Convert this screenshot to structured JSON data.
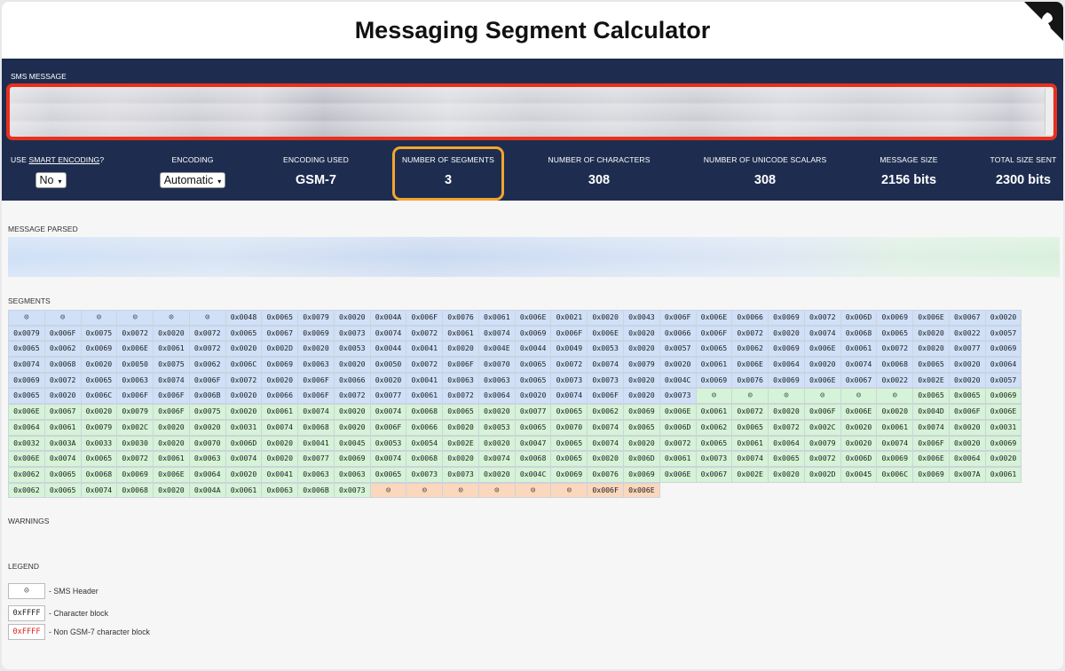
{
  "title": "Messaging Segment Calculator",
  "sms_label": "SMS MESSAGE",
  "stats": {
    "smart_prefix": "USE ",
    "smart_link": "SMART ENCODING",
    "smart_suffix": "?",
    "smart_value": "No",
    "encoding_label": "ENCODING",
    "encoding_value": "Automatic",
    "encoding_used_label": "ENCODING USED",
    "encoding_used_value": "GSM-7",
    "segments_label": "NUMBER OF SEGMENTS",
    "segments_value": "3",
    "chars_label": "NUMBER OF CHARACTERS",
    "chars_value": "308",
    "scalars_label": "NUMBER OF UNICODE SCALARS",
    "scalars_value": "308",
    "size_label": "MESSAGE SIZE",
    "size_value": "2156 bits",
    "total_label": "TOTAL SIZE SENT",
    "total_value": "2300 bits"
  },
  "sections": {
    "parsed": "MESSAGE PARSED",
    "segments": "SEGMENTS",
    "warnings": "WARNINGS",
    "legend": "LEGEND"
  },
  "legend": [
    {
      "box": "☺",
      "text": "- SMS Header"
    },
    {
      "box": "0xFFFF",
      "text": "- Character block"
    },
    {
      "box": "0xFFFF",
      "text": "- Non GSM-7 character block",
      "red": true
    }
  ],
  "colors": {
    "header_bg": "#1e2d4f",
    "segment1": "#cfe0f8",
    "segment2": "#d5f3d6",
    "segment3": "#fad7bd",
    "highlight_red": "#e8301c",
    "highlight_orange": "#f2a62e"
  },
  "segment_rows": [
    [
      [
        "H",
        "b"
      ],
      [
        "H",
        "b"
      ],
      [
        "H",
        "b"
      ],
      [
        "H",
        "b"
      ],
      [
        "H",
        "b"
      ],
      [
        "H",
        "b"
      ],
      [
        "0x0048",
        "b"
      ],
      [
        "0x0065",
        "b"
      ],
      [
        "0x0079",
        "b"
      ],
      [
        "0x0020",
        "b"
      ],
      [
        "0x004A",
        "b"
      ],
      [
        "0x006F",
        "b"
      ],
      [
        "0x0076",
        "b"
      ],
      [
        "0x0061",
        "b"
      ],
      [
        "0x006E",
        "b"
      ],
      [
        "0x0021",
        "b"
      ],
      [
        "0x0020",
        "b"
      ],
      [
        "0x0043",
        "b"
      ],
      [
        "0x006F",
        "b"
      ],
      [
        "0x006E",
        "b"
      ],
      [
        "0x0066",
        "b"
      ],
      [
        "0x0069",
        "b"
      ],
      [
        "0x0072",
        "b"
      ],
      [
        "0x006D",
        "b"
      ],
      [
        "0x0069",
        "b"
      ],
      [
        "0x006E",
        "b"
      ],
      [
        "0x0067",
        "b"
      ],
      [
        "0x0020",
        "b"
      ]
    ],
    [
      [
        "0x0079",
        "b"
      ],
      [
        "0x006F",
        "b"
      ],
      [
        "0x0075",
        "b"
      ],
      [
        "0x0072",
        "b"
      ],
      [
        "0x0020",
        "b"
      ],
      [
        "0x0072",
        "b"
      ],
      [
        "0x0065",
        "b"
      ],
      [
        "0x0067",
        "b"
      ],
      [
        "0x0069",
        "b"
      ],
      [
        "0x0073",
        "b"
      ],
      [
        "0x0074",
        "b"
      ],
      [
        "0x0072",
        "b"
      ],
      [
        "0x0061",
        "b"
      ],
      [
        "0x0074",
        "b"
      ],
      [
        "0x0069",
        "b"
      ],
      [
        "0x006F",
        "b"
      ],
      [
        "0x006E",
        "b"
      ],
      [
        "0x0020",
        "b"
      ],
      [
        "0x0066",
        "b"
      ],
      [
        "0x006F",
        "b"
      ],
      [
        "0x0072",
        "b"
      ],
      [
        "0x0020",
        "b"
      ],
      [
        "0x0074",
        "b"
      ],
      [
        "0x0068",
        "b"
      ],
      [
        "0x0065",
        "b"
      ],
      [
        "0x0020",
        "b"
      ],
      [
        "0x0022",
        "b"
      ],
      [
        "0x0057",
        "b"
      ]
    ],
    [
      [
        "0x0065",
        "b"
      ],
      [
        "0x0062",
        "b"
      ],
      [
        "0x0069",
        "b"
      ],
      [
        "0x006E",
        "b"
      ],
      [
        "0x0061",
        "b"
      ],
      [
        "0x0072",
        "b"
      ],
      [
        "0x0020",
        "b"
      ],
      [
        "0x002D",
        "b"
      ],
      [
        "0x0020",
        "b"
      ],
      [
        "0x0053",
        "b"
      ],
      [
        "0x0044",
        "b"
      ],
      [
        "0x0041",
        "b"
      ],
      [
        "0x0020",
        "b"
      ],
      [
        "0x004E",
        "b"
      ],
      [
        "0x0044",
        "b"
      ],
      [
        "0x0049",
        "b"
      ],
      [
        "0x0053",
        "b"
      ],
      [
        "0x0020",
        "b"
      ],
      [
        "0x0057",
        "b"
      ],
      [
        "0x0065",
        "b"
      ],
      [
        "0x0062",
        "b"
      ],
      [
        "0x0069",
        "b"
      ],
      [
        "0x006E",
        "b"
      ],
      [
        "0x0061",
        "b"
      ],
      [
        "0x0072",
        "b"
      ],
      [
        "0x0020",
        "b"
      ],
      [
        "0x0077",
        "b"
      ],
      [
        "0x0069",
        "b"
      ]
    ],
    [
      [
        "0x0074",
        "b"
      ],
      [
        "0x0068",
        "b"
      ],
      [
        "0x0020",
        "b"
      ],
      [
        "0x0050",
        "b"
      ],
      [
        "0x0075",
        "b"
      ],
      [
        "0x0062",
        "b"
      ],
      [
        "0x006C",
        "b"
      ],
      [
        "0x0069",
        "b"
      ],
      [
        "0x0063",
        "b"
      ],
      [
        "0x0020",
        "b"
      ],
      [
        "0x0050",
        "b"
      ],
      [
        "0x0072",
        "b"
      ],
      [
        "0x006F",
        "b"
      ],
      [
        "0x0070",
        "b"
      ],
      [
        "0x0065",
        "b"
      ],
      [
        "0x0072",
        "b"
      ],
      [
        "0x0074",
        "b"
      ],
      [
        "0x0079",
        "b"
      ],
      [
        "0x0020",
        "b"
      ],
      [
        "0x0061",
        "b"
      ],
      [
        "0x006E",
        "b"
      ],
      [
        "0x0064",
        "b"
      ],
      [
        "0x0020",
        "b"
      ],
      [
        "0x0074",
        "b"
      ],
      [
        "0x0068",
        "b"
      ],
      [
        "0x0065",
        "b"
      ],
      [
        "0x0020",
        "b"
      ],
      [
        "0x0064",
        "b"
      ]
    ],
    [
      [
        "0x0069",
        "b"
      ],
      [
        "0x0072",
        "b"
      ],
      [
        "0x0065",
        "b"
      ],
      [
        "0x0063",
        "b"
      ],
      [
        "0x0074",
        "b"
      ],
      [
        "0x006F",
        "b"
      ],
      [
        "0x0072",
        "b"
      ],
      [
        "0x0020",
        "b"
      ],
      [
        "0x006F",
        "b"
      ],
      [
        "0x0066",
        "b"
      ],
      [
        "0x0020",
        "b"
      ],
      [
        "0x0041",
        "b"
      ],
      [
        "0x0063",
        "b"
      ],
      [
        "0x0063",
        "b"
      ],
      [
        "0x0065",
        "b"
      ],
      [
        "0x0073",
        "b"
      ],
      [
        "0x0073",
        "b"
      ],
      [
        "0x0020",
        "b"
      ],
      [
        "0x004C",
        "b"
      ],
      [
        "0x0069",
        "b"
      ],
      [
        "0x0076",
        "b"
      ],
      [
        "0x0069",
        "b"
      ],
      [
        "0x006E",
        "b"
      ],
      [
        "0x0067",
        "b"
      ],
      [
        "0x0022",
        "b"
      ],
      [
        "0x002E",
        "b"
      ],
      [
        "0x0020",
        "b"
      ],
      [
        "0x0057",
        "b"
      ]
    ],
    [
      [
        "0x0065",
        "b"
      ],
      [
        "0x0020",
        "b"
      ],
      [
        "0x006C",
        "b"
      ],
      [
        "0x006F",
        "b"
      ],
      [
        "0x006F",
        "b"
      ],
      [
        "0x006B",
        "b"
      ],
      [
        "0x0020",
        "b"
      ],
      [
        "0x0066",
        "b"
      ],
      [
        "0x006F",
        "b"
      ],
      [
        "0x0072",
        "b"
      ],
      [
        "0x0077",
        "b"
      ],
      [
        "0x0061",
        "b"
      ],
      [
        "0x0072",
        "b"
      ],
      [
        "0x0064",
        "b"
      ],
      [
        "0x0020",
        "b"
      ],
      [
        "0x0074",
        "b"
      ],
      [
        "0x006F",
        "b"
      ],
      [
        "0x0020",
        "b"
      ],
      [
        "0x0073",
        "b"
      ],
      [
        "H",
        "g"
      ],
      [
        "H",
        "g"
      ],
      [
        "H",
        "g"
      ],
      [
        "H",
        "g"
      ],
      [
        "H",
        "g"
      ],
      [
        "H",
        "g"
      ],
      [
        "0x0065",
        "g"
      ],
      [
        "0x0065",
        "g"
      ],
      [
        "0x0069",
        "g"
      ]
    ],
    [
      [
        "0x006E",
        "g"
      ],
      [
        "0x0067",
        "g"
      ],
      [
        "0x0020",
        "g"
      ],
      [
        "0x0079",
        "g"
      ],
      [
        "0x006F",
        "g"
      ],
      [
        "0x0075",
        "g"
      ],
      [
        "0x0020",
        "g"
      ],
      [
        "0x0061",
        "g"
      ],
      [
        "0x0074",
        "g"
      ],
      [
        "0x0020",
        "g"
      ],
      [
        "0x0074",
        "g"
      ],
      [
        "0x0068",
        "g"
      ],
      [
        "0x0065",
        "g"
      ],
      [
        "0x0020",
        "g"
      ],
      [
        "0x0077",
        "g"
      ],
      [
        "0x0065",
        "g"
      ],
      [
        "0x0062",
        "g"
      ],
      [
        "0x0069",
        "g"
      ],
      [
        "0x006E",
        "g"
      ],
      [
        "0x0061",
        "g"
      ],
      [
        "0x0072",
        "g"
      ],
      [
        "0x0020",
        "g"
      ],
      [
        "0x006F",
        "g"
      ],
      [
        "0x006E",
        "g"
      ],
      [
        "0x0020",
        "g"
      ],
      [
        "0x004D",
        "g"
      ],
      [
        "0x006F",
        "g"
      ],
      [
        "0x006E",
        "g"
      ]
    ],
    [
      [
        "0x0064",
        "g"
      ],
      [
        "0x0061",
        "g"
      ],
      [
        "0x0079",
        "g"
      ],
      [
        "0x002C",
        "g"
      ],
      [
        "0x0020",
        "g"
      ],
      [
        "0x0020",
        "g"
      ],
      [
        "0x0031",
        "g"
      ],
      [
        "0x0074",
        "g"
      ],
      [
        "0x0068",
        "g"
      ],
      [
        "0x0020",
        "g"
      ],
      [
        "0x006F",
        "g"
      ],
      [
        "0x0066",
        "g"
      ],
      [
        "0x0020",
        "g"
      ],
      [
        "0x0053",
        "g"
      ],
      [
        "0x0065",
        "g"
      ],
      [
        "0x0070",
        "g"
      ],
      [
        "0x0074",
        "g"
      ],
      [
        "0x0065",
        "g"
      ],
      [
        "0x006D",
        "g"
      ],
      [
        "0x0062",
        "g"
      ],
      [
        "0x0065",
        "g"
      ],
      [
        "0x0072",
        "g"
      ],
      [
        "0x002C",
        "g"
      ],
      [
        "0x0020",
        "g"
      ],
      [
        "0x0061",
        "g"
      ],
      [
        "0x0074",
        "g"
      ],
      [
        "0x0020",
        "g"
      ],
      [
        "0x0031",
        "g"
      ]
    ],
    [
      [
        "0x0032",
        "g"
      ],
      [
        "0x003A",
        "g"
      ],
      [
        "0x0033",
        "g"
      ],
      [
        "0x0030",
        "g"
      ],
      [
        "0x0020",
        "g"
      ],
      [
        "0x0070",
        "g"
      ],
      [
        "0x006D",
        "g"
      ],
      [
        "0x0020",
        "g"
      ],
      [
        "0x0041",
        "g"
      ],
      [
        "0x0045",
        "g"
      ],
      [
        "0x0053",
        "g"
      ],
      [
        "0x0054",
        "g"
      ],
      [
        "0x002E",
        "g"
      ],
      [
        "0x0020",
        "g"
      ],
      [
        "0x0047",
        "g"
      ],
      [
        "0x0065",
        "g"
      ],
      [
        "0x0074",
        "g"
      ],
      [
        "0x0020",
        "g"
      ],
      [
        "0x0072",
        "g"
      ],
      [
        "0x0065",
        "g"
      ],
      [
        "0x0061",
        "g"
      ],
      [
        "0x0064",
        "g"
      ],
      [
        "0x0079",
        "g"
      ],
      [
        "0x0020",
        "g"
      ],
      [
        "0x0074",
        "g"
      ],
      [
        "0x006F",
        "g"
      ],
      [
        "0x0020",
        "g"
      ],
      [
        "0x0069",
        "g"
      ]
    ],
    [
      [
        "0x006E",
        "g"
      ],
      [
        "0x0074",
        "g"
      ],
      [
        "0x0065",
        "g"
      ],
      [
        "0x0072",
        "g"
      ],
      [
        "0x0061",
        "g"
      ],
      [
        "0x0063",
        "g"
      ],
      [
        "0x0074",
        "g"
      ],
      [
        "0x0020",
        "g"
      ],
      [
        "0x0077",
        "g"
      ],
      [
        "0x0069",
        "g"
      ],
      [
        "0x0074",
        "g"
      ],
      [
        "0x0068",
        "g"
      ],
      [
        "0x0020",
        "g"
      ],
      [
        "0x0074",
        "g"
      ],
      [
        "0x0068",
        "g"
      ],
      [
        "0x0065",
        "g"
      ],
      [
        "0x0020",
        "g"
      ],
      [
        "0x006D",
        "g"
      ],
      [
        "0x0061",
        "g"
      ],
      [
        "0x0073",
        "g"
      ],
      [
        "0x0074",
        "g"
      ],
      [
        "0x0065",
        "g"
      ],
      [
        "0x0072",
        "g"
      ],
      [
        "0x006D",
        "g"
      ],
      [
        "0x0069",
        "g"
      ],
      [
        "0x006E",
        "g"
      ],
      [
        "0x0064",
        "g"
      ],
      [
        "0x0020",
        "g"
      ]
    ],
    [
      [
        "0x0062",
        "g"
      ],
      [
        "0x0065",
        "g"
      ],
      [
        "0x0068",
        "g"
      ],
      [
        "0x0069",
        "g"
      ],
      [
        "0x006E",
        "g"
      ],
      [
        "0x0064",
        "g"
      ],
      [
        "0x0020",
        "g"
      ],
      [
        "0x0041",
        "g"
      ],
      [
        "0x0063",
        "g"
      ],
      [
        "0x0063",
        "g"
      ],
      [
        "0x0065",
        "g"
      ],
      [
        "0x0073",
        "g"
      ],
      [
        "0x0073",
        "g"
      ],
      [
        "0x0020",
        "g"
      ],
      [
        "0x004C",
        "g"
      ],
      [
        "0x0069",
        "g"
      ],
      [
        "0x0076",
        "g"
      ],
      [
        "0x0069",
        "g"
      ],
      [
        "0x006E",
        "g"
      ],
      [
        "0x0067",
        "g"
      ],
      [
        "0x002E",
        "g"
      ],
      [
        "0x0020",
        "g"
      ],
      [
        "0x002D",
        "g"
      ],
      [
        "0x0045",
        "g"
      ],
      [
        "0x006C",
        "g"
      ],
      [
        "0x0069",
        "g"
      ],
      [
        "0x007A",
        "g"
      ],
      [
        "0x0061",
        "g"
      ]
    ],
    [
      [
        "0x0062",
        "g"
      ],
      [
        "0x0065",
        "g"
      ],
      [
        "0x0074",
        "g"
      ],
      [
        "0x0068",
        "g"
      ],
      [
        "0x0020",
        "g"
      ],
      [
        "0x004A",
        "g"
      ],
      [
        "0x0061",
        "g"
      ],
      [
        "0x0063",
        "g"
      ],
      [
        "0x006B",
        "g"
      ],
      [
        "0x0073",
        "g"
      ],
      [
        "H",
        "o"
      ],
      [
        "H",
        "o"
      ],
      [
        "H",
        "o"
      ],
      [
        "H",
        "o"
      ],
      [
        "H",
        "o"
      ],
      [
        "H",
        "o"
      ],
      [
        "0x006F",
        "o"
      ],
      [
        "0x006E",
        "o"
      ]
    ]
  ]
}
